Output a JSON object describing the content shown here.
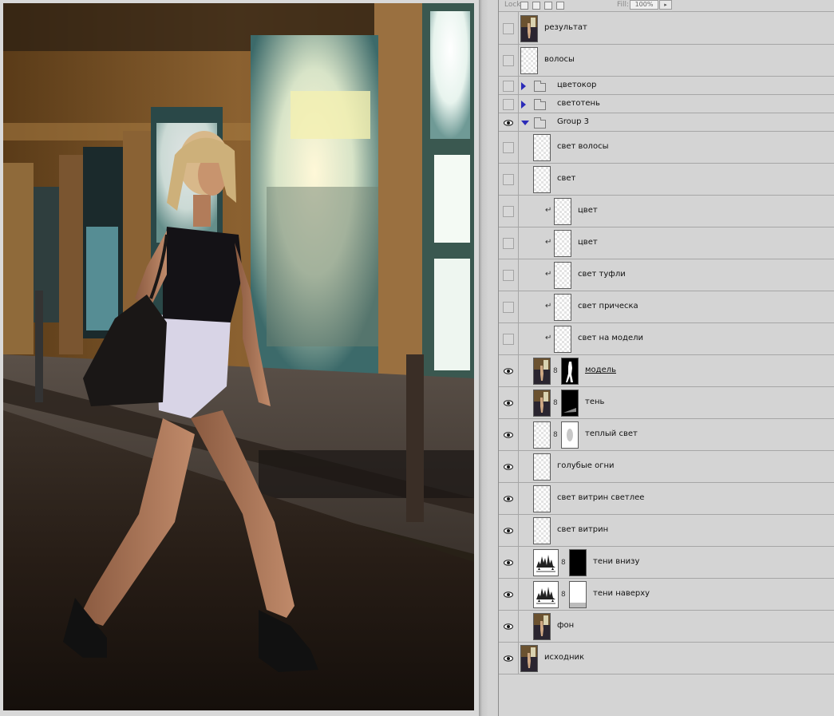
{
  "panel": {
    "lock_label": "Lock:",
    "fill_label": "Fill:",
    "fill_value": "100%"
  },
  "layers": [
    {
      "name": "результат",
      "visible": false
    },
    {
      "name": "волосы",
      "visible": false
    },
    {
      "name": "цветокор",
      "visible": false,
      "type": "group",
      "expanded": false
    },
    {
      "name": "светотень",
      "visible": false,
      "type": "group",
      "expanded": false
    },
    {
      "name": "Group 3",
      "visible": true,
      "type": "group",
      "expanded": true
    },
    {
      "name": "свет волосы",
      "visible": false
    },
    {
      "name": "свет",
      "visible": false
    },
    {
      "name": "цвет",
      "visible": false,
      "clipped": true
    },
    {
      "name": "цвет",
      "visible": false,
      "clipped": true
    },
    {
      "name": "свет туфли",
      "visible": false,
      "clipped": true
    },
    {
      "name": "свет прическа",
      "visible": false,
      "clipped": true
    },
    {
      "name": "свет на модели",
      "visible": false,
      "clipped": true
    },
    {
      "name": "модель",
      "visible": true,
      "has_mask": true,
      "selected": true
    },
    {
      "name": "тень",
      "visible": true,
      "has_mask": true
    },
    {
      "name": "теплый свет",
      "visible": true,
      "has_mask": true
    },
    {
      "name": "голубые огни",
      "visible": true
    },
    {
      "name": "свет витрин светлее",
      "visible": true
    },
    {
      "name": "свет витрин",
      "visible": true
    },
    {
      "name": "тени внизу",
      "visible": true,
      "type": "adjustment",
      "has_mask": true
    },
    {
      "name": "тени наверху",
      "visible": true,
      "type": "adjustment",
      "has_mask": true
    },
    {
      "name": "фон",
      "visible": true
    },
    {
      "name": "исходник",
      "visible": true
    }
  ],
  "icons": {
    "eye": "eye-icon",
    "group": "folder-icon",
    "expand": "triangle-right-icon",
    "collapse": "triangle-down-icon",
    "link": "chain-link-icon",
    "clip": "clipping-arrow-icon"
  },
  "colors": {
    "panel_bg": "#d4d4d4",
    "row_border": "#a6a6a6",
    "group_triangle": "#2b2bb8"
  }
}
